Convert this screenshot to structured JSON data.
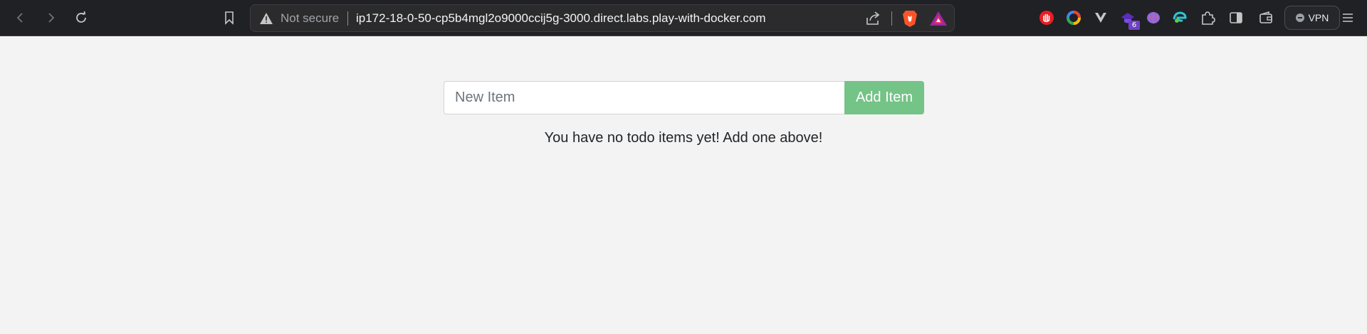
{
  "browser": {
    "url_security_label": "Not secure",
    "url": "ip172-18-0-50-cp5b4mgl2o9000ccij5g-3000.direct.labs.play-with-docker.com",
    "extension_badge_count": "6",
    "vpn_label": "VPN",
    "icons": [
      "back-icon",
      "forward-icon",
      "reload-icon",
      "bookmark-icon",
      "warning-icon",
      "share-icon",
      "brave-shields-icon",
      "brave-rewards-icon",
      "stop-hand-extension-icon",
      "color-ring-extension-icon",
      "vivaldi-extension-icon",
      "purple-extension-icon",
      "brain-extension-icon",
      "edge-extension-icon",
      "extensions-puzzle-icon",
      "sidebar-icon",
      "wallet-icon",
      "menu-icon"
    ]
  },
  "todo": {
    "input_placeholder": "New Item",
    "input_value": "",
    "add_button_label": "Add Item",
    "add_button_color": "#74c387",
    "empty_message": "You have no todo items yet! Add one above!"
  }
}
